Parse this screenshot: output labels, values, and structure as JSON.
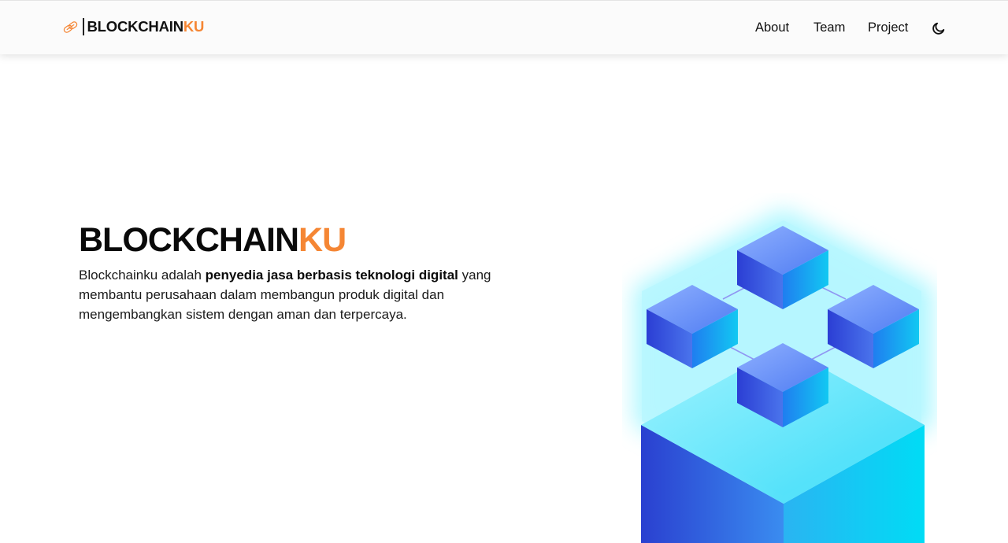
{
  "header": {
    "brand": {
      "name_main": "BLOCKCHAIN",
      "name_accent": "KU",
      "logo_icon": "chain-link-icon"
    },
    "nav": [
      {
        "label": "About"
      },
      {
        "label": "Team"
      },
      {
        "label": "Project"
      }
    ],
    "theme_toggle_icon": "moon-icon"
  },
  "hero": {
    "title_main": "BLOCKCHAIN",
    "title_accent": "KU",
    "description": {
      "intro": "Blockchainku adalah ",
      "highlight": "penyedia jasa berbasis teknologi digital",
      "rest": " yang membantu perusahaan dalam membangun produk digital dan mengembangkan sistem dengan aman dan terpercaya."
    },
    "illustration_icon": "blockchain-cubes-illustration"
  },
  "colors": {
    "accent": "#f58634",
    "text": "#111111",
    "navbar_bg": "#fbfbfb",
    "cyan": "#00d8f5",
    "blue": "#2f4bd6"
  }
}
